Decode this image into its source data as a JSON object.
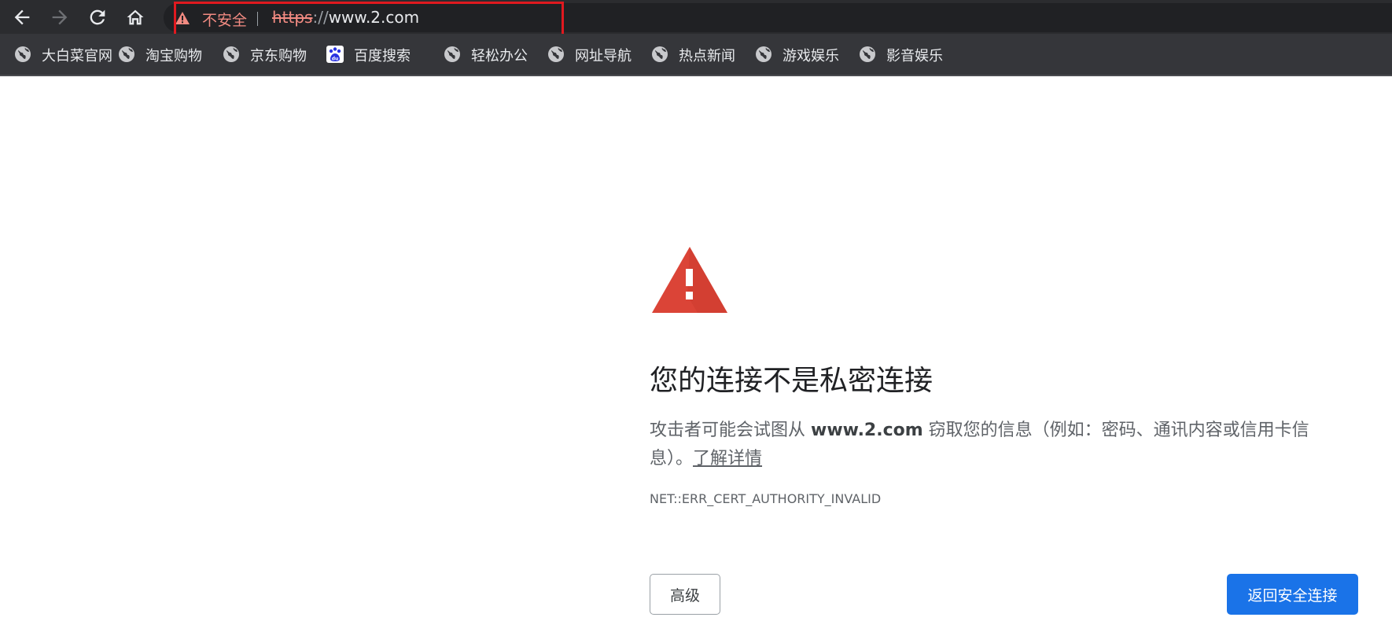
{
  "toolbar": {
    "nav_icons": [
      "back-arrow-icon",
      "forward-arrow-icon",
      "reload-icon",
      "home-icon"
    ],
    "omnibox": {
      "security_label": "不安全",
      "url_scheme": "https",
      "url_separator": "://",
      "url_host": "www.2.com",
      "warning_color": "#f28b82"
    },
    "highlight_color": "#e0191f"
  },
  "bookmarks": [
    {
      "label": "大白菜官网",
      "icon": "globe-icon"
    },
    {
      "label": "淘宝购物",
      "icon": "globe-icon"
    },
    {
      "label": "京东购物",
      "icon": "globe-icon"
    },
    {
      "label": "百度搜索",
      "icon": "baidu-paw-icon"
    },
    {
      "label": "轻松办公",
      "icon": "globe-icon"
    },
    {
      "label": "网址导航",
      "icon": "globe-icon"
    },
    {
      "label": "热点新闻",
      "icon": "globe-icon"
    },
    {
      "label": "游戏娱乐",
      "icon": "globe-icon"
    },
    {
      "label": "影音娱乐",
      "icon": "globe-icon"
    }
  ],
  "interstitial": {
    "warning_icon": "warning-triangle-icon",
    "warning_icon_color": "#db4437",
    "title": "您的连接不是私密连接",
    "body_prefix": "攻击者可能会试图从 ",
    "body_host": "www.2.com",
    "body_suffix": " 窃取您的信息（例如：密码、通讯内容或信用卡信息）。",
    "learn_more": "了解详情",
    "error_code": "NET::ERR_CERT_AUTHORITY_INVALID",
    "advanced_button": "高级",
    "back_button": "返回安全连接",
    "primary_color": "#1a73e8"
  }
}
